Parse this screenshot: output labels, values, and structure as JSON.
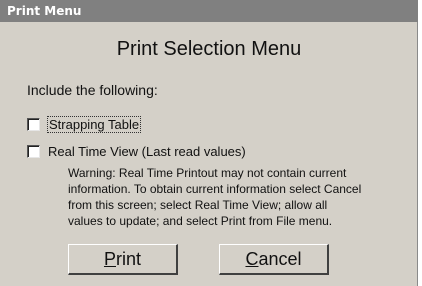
{
  "window": {
    "title": "Print Menu"
  },
  "dialog": {
    "heading": "Print Selection Menu",
    "include_label": "Include the following:",
    "options": [
      {
        "label": "Strapping Table",
        "checked": false
      },
      {
        "label": "Real Time View (Last read values)",
        "checked": false
      }
    ],
    "warning_lines": [
      "Warning:  Real Time Printout may not contain current",
      "information.  To obtain current  information select Cancel",
      "from this screen; select Real Time View; allow all",
      "values to  update; and select Print from File menu."
    ]
  },
  "buttons": {
    "print": {
      "mnemonic": "P",
      "rest": "rint"
    },
    "cancel": {
      "mnemonic": "C",
      "rest": "ancel"
    }
  },
  "colors": {
    "titlebar": "#808080",
    "dialog_bg": "#d4d0c8"
  }
}
